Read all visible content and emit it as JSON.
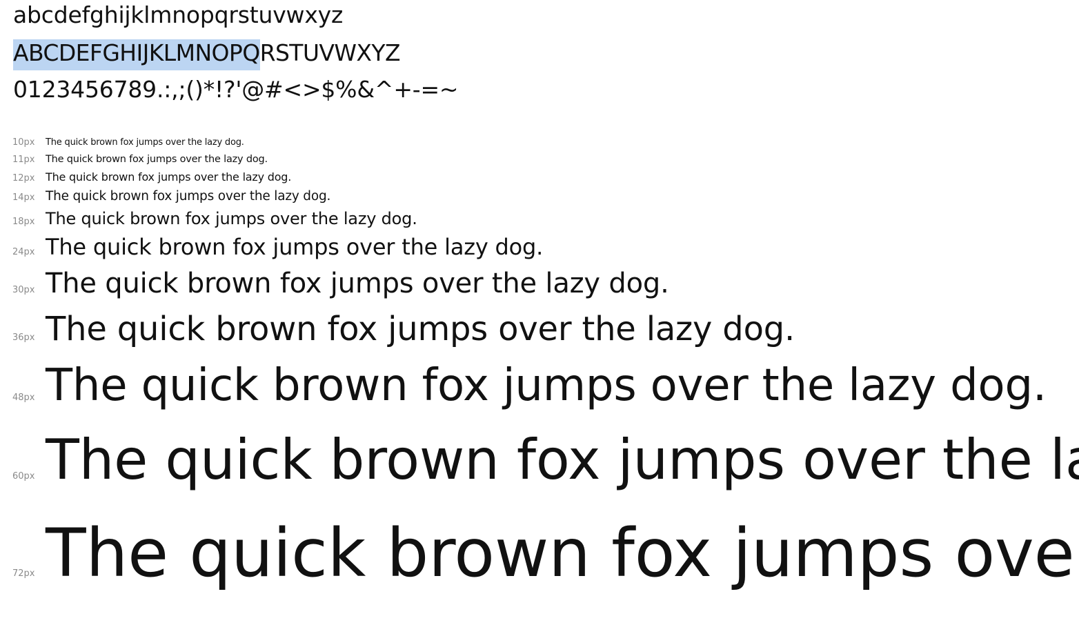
{
  "specimen": {
    "lowercase": "abcdefghijklmnopqrstuvwxyz",
    "uppercase_selected": "ABCDEFGHIJKLMNOPQ",
    "uppercase_rest": "RSTUVWXYZ",
    "symbols": "0123456789.:,;()*!?'@#<>$%&^+-=~",
    "selection_color": "#bcd5f2"
  },
  "waterfall": {
    "sample_text": "The quick brown fox jumps over the lazy dog.",
    "sizes": [
      "10px",
      "11px",
      "12px",
      "14px",
      "18px",
      "24px",
      "30px",
      "36px",
      "48px",
      "60px",
      "72px"
    ]
  }
}
